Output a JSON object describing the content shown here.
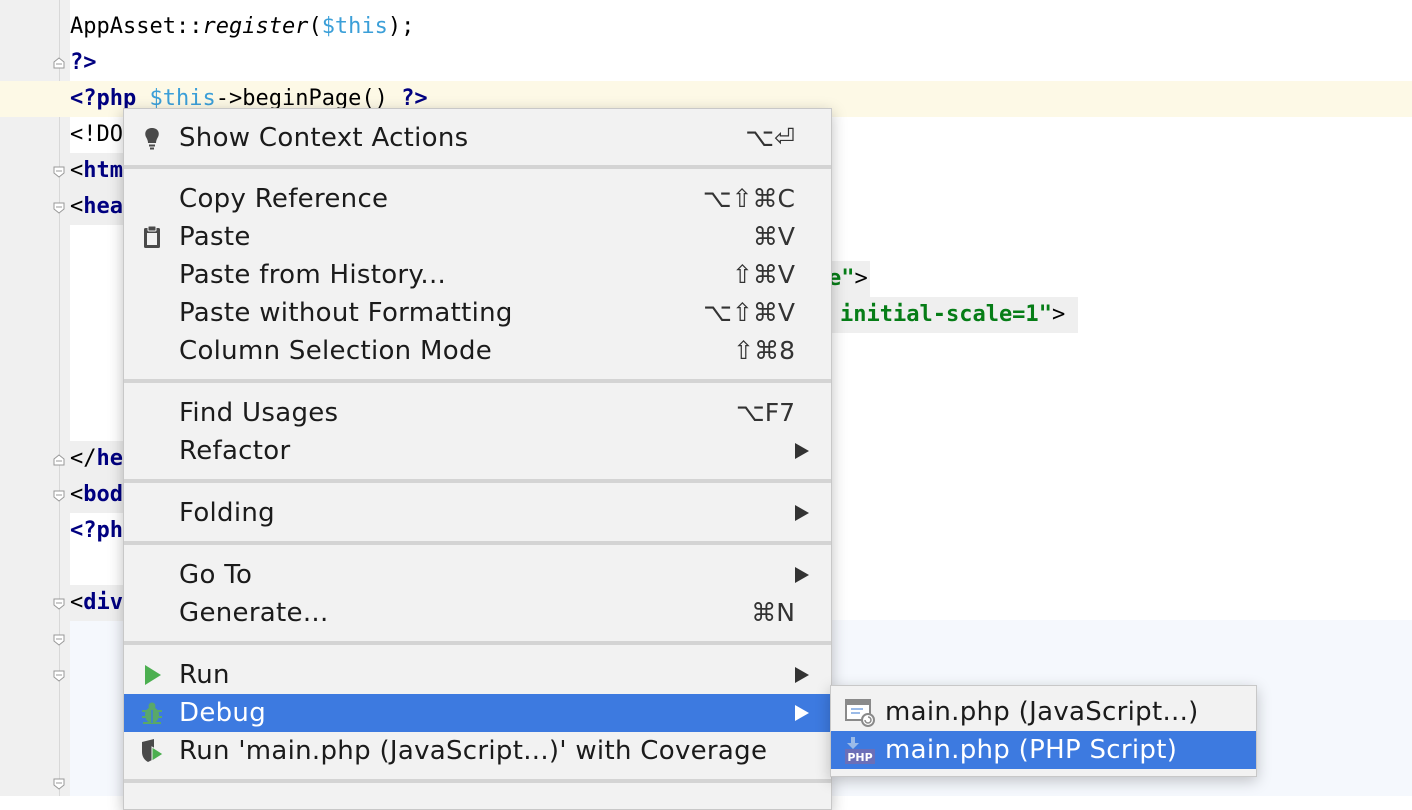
{
  "editor": {
    "line1": {
      "class_name": "AppAsset",
      "sep": "::",
      "method": "register",
      "open": "(",
      "var": "$this",
      "close": ");"
    },
    "line2": {
      "text": "?>"
    },
    "line3": {
      "open_tag": "<?php",
      "var": "$this",
      "arrow": "->",
      "call": "beginPage()",
      "close_tag": "?>"
    },
    "line4": {
      "text": "<!DO"
    },
    "line5": {
      "lt": "<",
      "tag": "htm"
    },
    "line6": {
      "lt": "<",
      "tag": "hea"
    },
    "line7": {
      "str": "e\"",
      "gt": ">"
    },
    "line8": {
      "str": "initial-scale=1",
      "quote": "\"",
      "gt": ">"
    },
    "line9": {
      "lt": "</",
      "tag": "he"
    },
    "line10": {
      "lt": "<",
      "tag": "bod"
    },
    "line11": {
      "text": "<?ph"
    },
    "line12": {
      "lt": "<",
      "tag": "div"
    }
  },
  "context_menu": {
    "items": [
      {
        "label": "Show Context Actions",
        "shortcut": "⌥⏎",
        "icon": "lightbulb-icon"
      },
      {
        "label": "Copy Reference",
        "shortcut": "⌥⇧⌘C"
      },
      {
        "label": "Paste",
        "shortcut": "⌘V",
        "icon": "clipboard-icon"
      },
      {
        "label": "Paste from History...",
        "shortcut": "⇧⌘V"
      },
      {
        "label": "Paste without Formatting",
        "shortcut": "⌥⇧⌘V"
      },
      {
        "label": "Column Selection Mode",
        "shortcut": "⇧⌘8"
      },
      {
        "label": "Find Usages",
        "shortcut": "⌥F7"
      },
      {
        "label": "Refactor",
        "submenu": true
      },
      {
        "label": "Folding",
        "submenu": true
      },
      {
        "label": "Go To",
        "submenu": true
      },
      {
        "label": "Generate...",
        "shortcut": "⌘N"
      },
      {
        "label": "Run",
        "submenu": true,
        "icon": "run-icon"
      },
      {
        "label": "Debug",
        "submenu": true,
        "icon": "debug-bug-icon",
        "selected": true
      },
      {
        "label": "Run 'main.php (JavaScript...)' with Coverage",
        "icon": "coverage-icon"
      }
    ]
  },
  "debug_submenu": {
    "items": [
      {
        "label": "main.php (JavaScript...)",
        "icon": "javascript-debug-icon"
      },
      {
        "label": "main.php (PHP Script)",
        "icon": "php-script-icon",
        "icon_text": "PHP",
        "selected": true
      }
    ]
  },
  "colors": {
    "selection": "#3d7ae0",
    "menu_bg": "#f2f2f2",
    "caret_row": "#fdf9e6",
    "keyword": "#000080",
    "variable": "#3b9fd8",
    "string": "#067d17"
  }
}
